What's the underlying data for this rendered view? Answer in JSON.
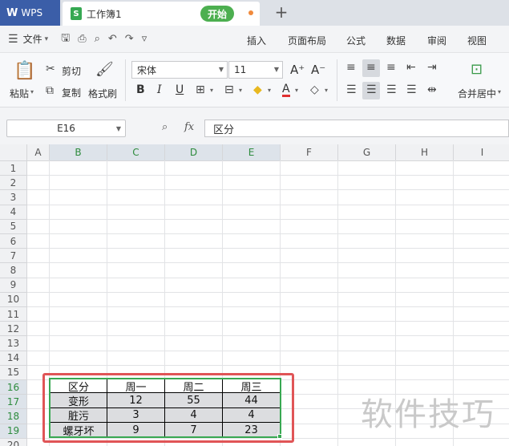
{
  "tabs": {
    "app_name": "WPS",
    "doc_title": "工作簿1",
    "doc_icon": "S",
    "new_tab": "+"
  },
  "menu": {
    "file": "文件",
    "start": "开始",
    "items": [
      "插入",
      "页面布局",
      "公式",
      "数据",
      "审阅",
      "视图"
    ]
  },
  "ribbon": {
    "paste": "粘贴",
    "cut": "剪切",
    "copy": "复制",
    "format_painter": "格式刷",
    "font_name": "宋体",
    "font_size": "11",
    "merge_center": "合并居中",
    "bold": "B",
    "italic": "I",
    "underline": "U",
    "font_color_letter": "A",
    "increase_font": "A⁺",
    "decrease_font": "A⁻"
  },
  "formula_bar": {
    "cell_ref": "E16",
    "fx_label": "fx",
    "value": "区分"
  },
  "columns": [
    "A",
    "B",
    "C",
    "D",
    "E",
    "F",
    "G",
    "H",
    "I"
  ],
  "rows": [
    "1",
    "2",
    "3",
    "4",
    "5",
    "6",
    "7",
    "8",
    "9",
    "10",
    "11",
    "12",
    "13",
    "14",
    "15",
    "16",
    "17",
    "18",
    "19",
    "20"
  ],
  "table": {
    "headers": [
      "区分",
      "周一",
      "周二",
      "周三"
    ],
    "rows": [
      [
        "变形",
        "12",
        "55",
        "44"
      ],
      [
        "脏污",
        "3",
        "4",
        "4"
      ],
      [
        "螺牙坏",
        "9",
        "7",
        "23"
      ]
    ]
  },
  "watermark": "软件技巧",
  "colors": {
    "accent_green": "#38a852",
    "highlight_red": "#e05557",
    "wps_blue": "#3b5ea8"
  }
}
